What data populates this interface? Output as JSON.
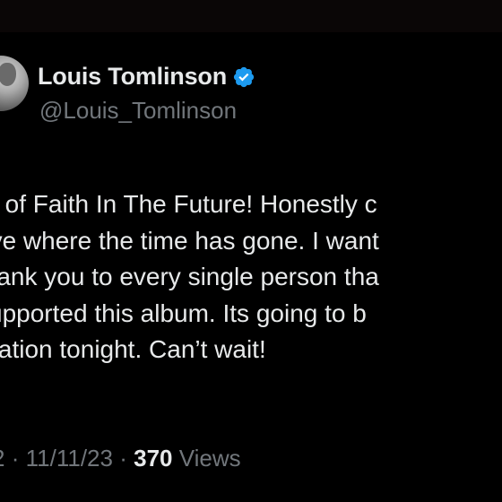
{
  "profile": {
    "display_name": "Louis Tomlinson",
    "handle": "@Louis_Tomlinson",
    "verified_color": "#1d9bf0"
  },
  "tweet": {
    "lines": [
      "ar of Faith In The Future! Honestly c",
      "eve where the time has gone. I want",
      "thank you to every single person tha",
      "supported this album. Its going to b",
      "bration tonight. Can’t wait!"
    ]
  },
  "meta": {
    "time_fragment": "2",
    "separator": "·",
    "date": "11/11/23",
    "views_count": "370",
    "views_label": "Views"
  },
  "icons": {
    "verified": "verified-badge-icon",
    "avatar": "profile-photo"
  }
}
